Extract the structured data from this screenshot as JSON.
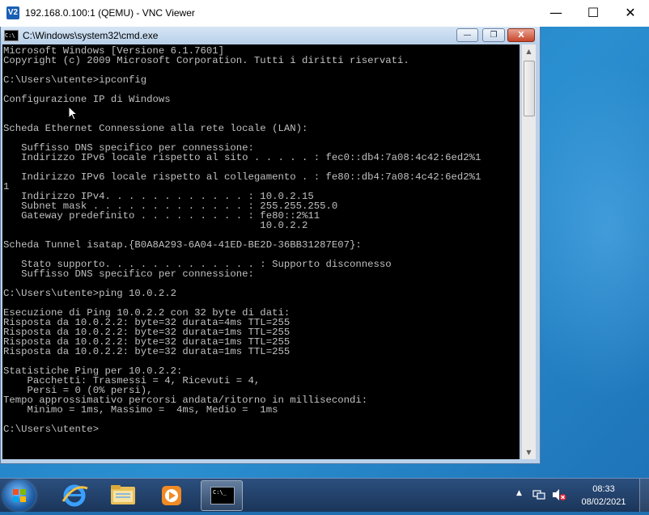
{
  "vnc": {
    "title": "192.168.0.100:1 (QEMU) - VNC Viewer",
    "icon_text": "V2",
    "minimize": "—",
    "maximize": "☐",
    "close": "✕"
  },
  "cmd": {
    "title": "C:\\Windows\\system32\\cmd.exe",
    "icon_text": "C:\\",
    "console_lines": [
      "Microsoft Windows [Versione 6.1.7601]",
      "Copyright (c) 2009 Microsoft Corporation. Tutti i diritti riservati.",
      "",
      "C:\\Users\\utente>ipconfig",
      "",
      "Configurazione IP di Windows",
      "",
      "",
      "Scheda Ethernet Connessione alla rete locale (LAN):",
      "",
      "   Suffisso DNS specifico per connessione:",
      "   Indirizzo IPv6 locale rispetto al sito . . . . . : fec0::db4:7a08:4c42:6ed2%1",
      "",
      "   Indirizzo IPv6 locale rispetto al collegamento . : fe80::db4:7a08:4c42:6ed2%1",
      "1",
      "   Indirizzo IPv4. . . . . . . . . . . . : 10.0.2.15",
      "   Subnet mask . . . . . . . . . . . . . : 255.255.255.0",
      "   Gateway predefinito . . . . . . . . . : fe80::2%11",
      "                                           10.0.2.2",
      "",
      "Scheda Tunnel isatap.{B0A8A293-6A04-41ED-BE2D-36BB31287E07}:",
      "",
      "   Stato supporto. . . . . . . . . . . . . : Supporto disconnesso",
      "   Suffisso DNS specifico per connessione:",
      "",
      "C:\\Users\\utente>ping 10.0.2.2",
      "",
      "Esecuzione di Ping 10.0.2.2 con 32 byte di dati:",
      "Risposta da 10.0.2.2: byte=32 durata=4ms TTL=255",
      "Risposta da 10.0.2.2: byte=32 durata=1ms TTL=255",
      "Risposta da 10.0.2.2: byte=32 durata=1ms TTL=255",
      "Risposta da 10.0.2.2: byte=32 durata=1ms TTL=255",
      "",
      "Statistiche Ping per 10.0.2.2:",
      "    Pacchetti: Trasmessi = 4, Ricevuti = 4,",
      "    Persi = 0 (0% persi),",
      "Tempo approssimativo percorsi andata/ritorno in millisecondi:",
      "    Minimo = 1ms, Massimo =  4ms, Medio =  1ms",
      "",
      "C:\\Users\\utente>"
    ],
    "scroll_up": "▲",
    "scroll_down": "▼",
    "btn_minimize": "—",
    "btn_maximize": "❐",
    "btn_close": "X"
  },
  "taskbar": {
    "cmd_label": "C:\\_",
    "time": "08:33",
    "date": "08/02/2021",
    "tray_arrow": "▲"
  },
  "colors": {
    "console_bg": "#000000",
    "console_fg": "#c0c0c0",
    "desktop": "#1f78c0"
  }
}
